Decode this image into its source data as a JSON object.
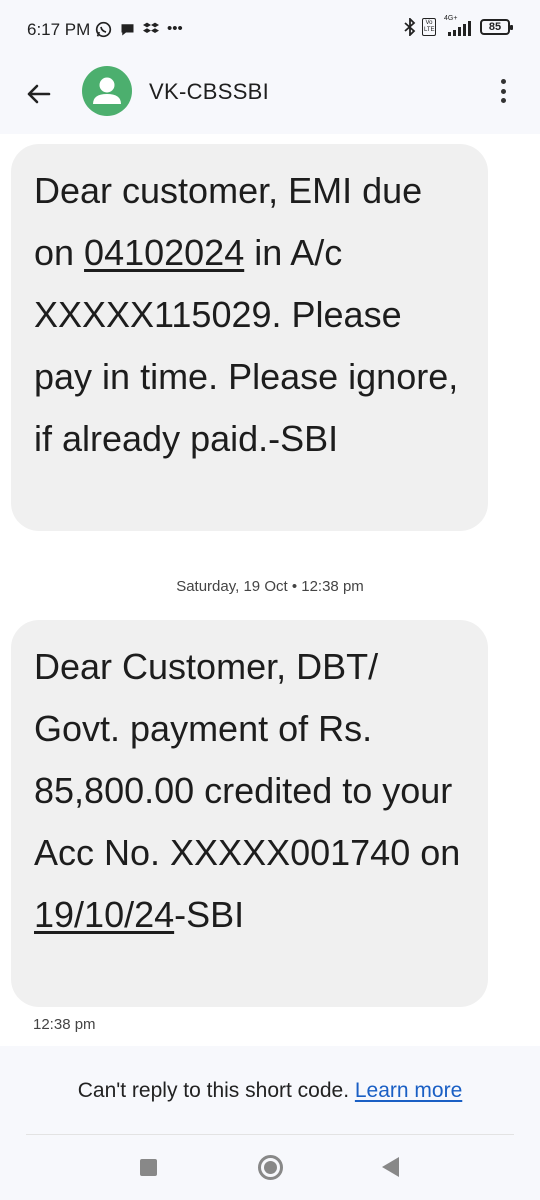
{
  "status_bar": {
    "time": "6:17 PM",
    "network_type": "4G+",
    "volte": "Vo LTE",
    "battery": "85",
    "overflow_dots": "•••"
  },
  "header": {
    "contact_name": "VK-CBSSBI",
    "avatar_color": "#4caf6e"
  },
  "messages": [
    {
      "parts": [
        {
          "text": "Dear customer, EMI due on "
        },
        {
          "text": "04102024",
          "link": true
        },
        {
          "text": " in A/c XXXXX115029. Please pay in time. Please ignore, if already paid.-SBI"
        }
      ]
    },
    {
      "parts": [
        {
          "text": "Dear Customer, DBT/ Govt. payment of Rs. 85,800.00 credited to your Acc No. XXXXX001740 on "
        },
        {
          "text": "19/10/24",
          "link": true
        },
        {
          "text": "-SBI"
        }
      ]
    }
  ],
  "date_separator": "Saturday, 19 Oct • 12:38 pm",
  "last_timestamp": "12:38 pm",
  "reply_bar": {
    "text": "Can't reply to this short code. ",
    "learn_more": "Learn more",
    "link_color": "#1a5fc4"
  }
}
